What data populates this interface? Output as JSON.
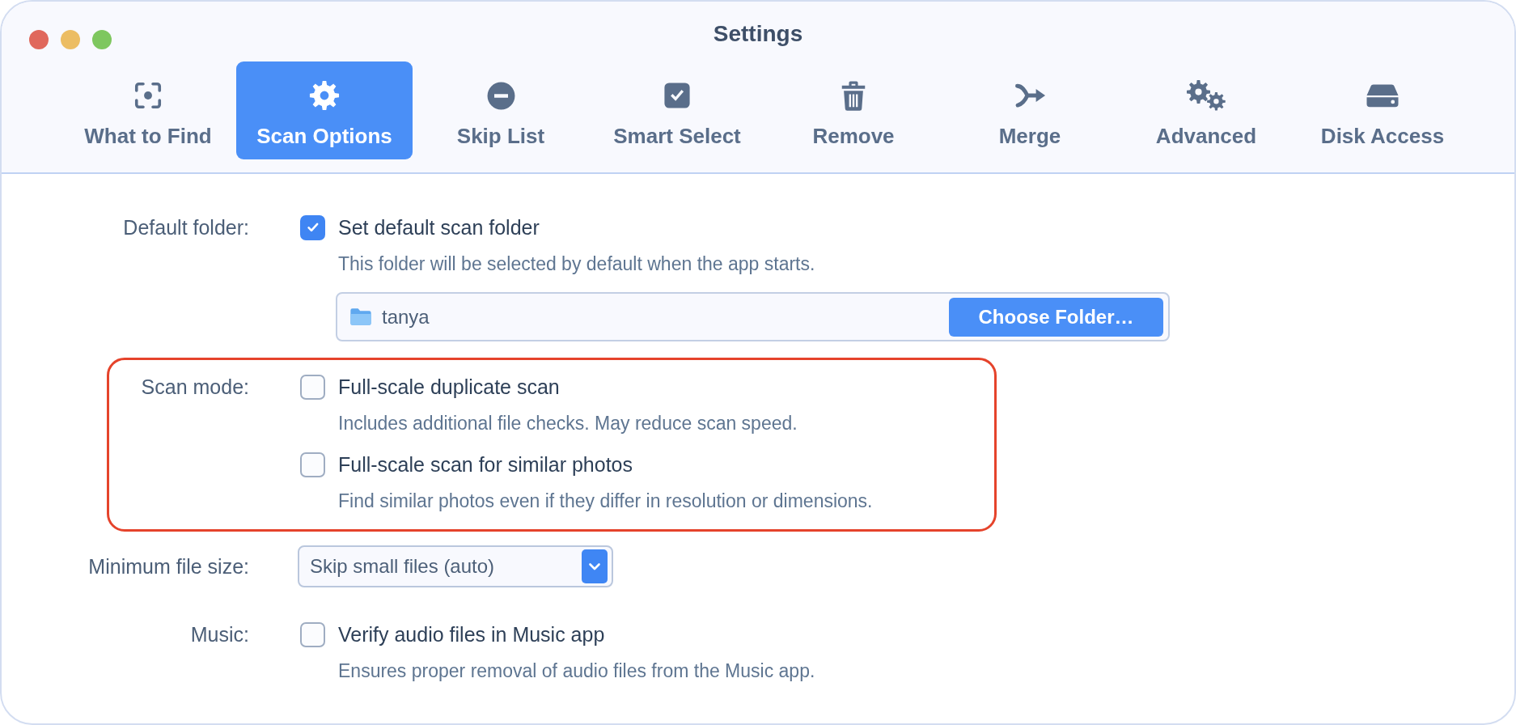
{
  "window": {
    "title": "Settings",
    "buttons": [
      {
        "color": "#e0685c"
      },
      {
        "color": "#ecbd63"
      },
      {
        "color": "#7ec75f"
      }
    ]
  },
  "tabs": [
    {
      "label": "What to Find",
      "selected": false
    },
    {
      "label": "Scan Options",
      "selected": true
    },
    {
      "label": "Skip List",
      "selected": false
    },
    {
      "label": "Smart Select",
      "selected": false
    },
    {
      "label": "Remove",
      "selected": false
    },
    {
      "label": "Merge",
      "selected": false
    },
    {
      "label": "Advanced",
      "selected": false
    },
    {
      "label": "Disk Access",
      "selected": false
    }
  ],
  "sections": [
    {
      "kind": "options",
      "label": "Default folder:",
      "highlighted": false,
      "options": [
        {
          "label": "Set default scan folder",
          "checked": true,
          "description": "This folder will be selected by default when the app starts."
        }
      ],
      "folder": {
        "value": "tanya",
        "button": "Choose Folder…"
      }
    },
    {
      "kind": "options",
      "label": "Scan mode:",
      "highlighted": true,
      "options": [
        {
          "label": "Full-scale duplicate scan",
          "checked": false,
          "description": "Includes additional file checks. May reduce scan speed."
        },
        {
          "label": "Full-scale scan for similar photos",
          "checked": false,
          "description": "Find similar photos even if they differ in resolution or dimensions."
        }
      ]
    },
    {
      "kind": "select",
      "label": "Minimum file size:",
      "highlighted": false,
      "value": "Skip small files (auto)"
    },
    {
      "kind": "options",
      "label": "Music:",
      "highlighted": false,
      "options": [
        {
          "label": "Verify audio files in Music app",
          "checked": false,
          "description": "Ensures proper removal of audio files from the Music app."
        }
      ]
    }
  ]
}
